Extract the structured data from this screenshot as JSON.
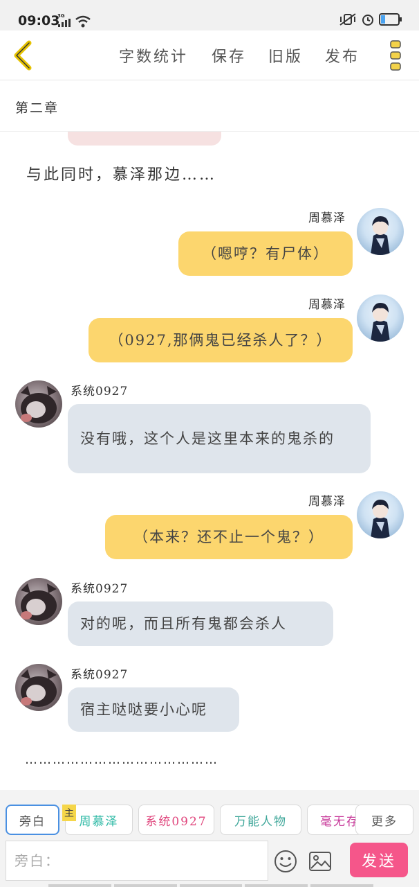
{
  "status_bar": {
    "time": "09:03",
    "network": "3G"
  },
  "toolbar": {
    "items": [
      "字数统计",
      "保存",
      "旧版",
      "发布"
    ]
  },
  "chapter": {
    "title": "第二章"
  },
  "narration": "与此同时，慕泽那边……",
  "messages": [
    {
      "speaker": "周慕泽",
      "side": "right",
      "text": "（嗯哼？有尸体）"
    },
    {
      "speaker": "周慕泽",
      "side": "right",
      "text": "（0927,那俩鬼已经杀人了？）"
    },
    {
      "speaker": "系统0927",
      "side": "left",
      "text": "没有哦，这个人是这里本来的鬼杀的"
    },
    {
      "speaker": "周慕泽",
      "side": "right",
      "text": "（本来？还不止一个鬼？）"
    },
    {
      "speaker": "系统0927",
      "side": "left",
      "text": "对的呢，而且所有鬼都会杀人"
    },
    {
      "speaker": "系统0927",
      "side": "left",
      "text": "宿主哒哒要小心呢"
    }
  ],
  "ellipsis": "……………………………………",
  "roles": {
    "narrator": "旁白",
    "main_tag": "主",
    "items": [
      "周慕泽",
      "系统0927",
      "万能人物",
      "毫无存"
    ],
    "more": "更多"
  },
  "input": {
    "placeholder": "旁白："
  },
  "send_label": "发送",
  "colors": {
    "yellow_bubble": "#fcd66e",
    "gray_bubble": "#dfe5ec",
    "send": "#f5568a",
    "accent_back": "#e6b800"
  }
}
